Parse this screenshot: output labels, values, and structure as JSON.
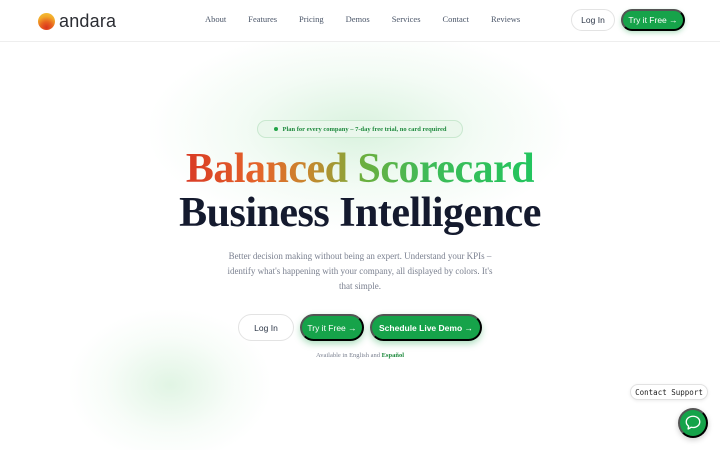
{
  "brand": {
    "name": "andara",
    "icon": "andara-logo-icon"
  },
  "nav": {
    "links": [
      "About",
      "Features",
      "Pricing",
      "Demos",
      "Services",
      "Contact",
      "Reviews"
    ],
    "login_label": "Log In",
    "try_label": "Try it Free →"
  },
  "hero": {
    "badge": "Plan for every company – 7-day free trial, no card required",
    "title_word1": "Balanced",
    "title_word2": "Scorecard",
    "title_line2": "Business Intelligence",
    "subtitle": "Better decision making without being an expert. Understand your KPIs – identify what's happening with your company, all displayed by colors. It's that simple.",
    "login_label": "Log In",
    "try_label": "Try it Free →",
    "demo_label": "Schedule Live Demo →",
    "available_prefix": "Available in English and",
    "available_link": "Español"
  },
  "support": {
    "label": "Contact Support",
    "icon": "chat-bubble-icon"
  },
  "colors": {
    "accent": "#16a34a",
    "title_dark": "#141a2e",
    "badge_bg": "#eaf7ec"
  }
}
